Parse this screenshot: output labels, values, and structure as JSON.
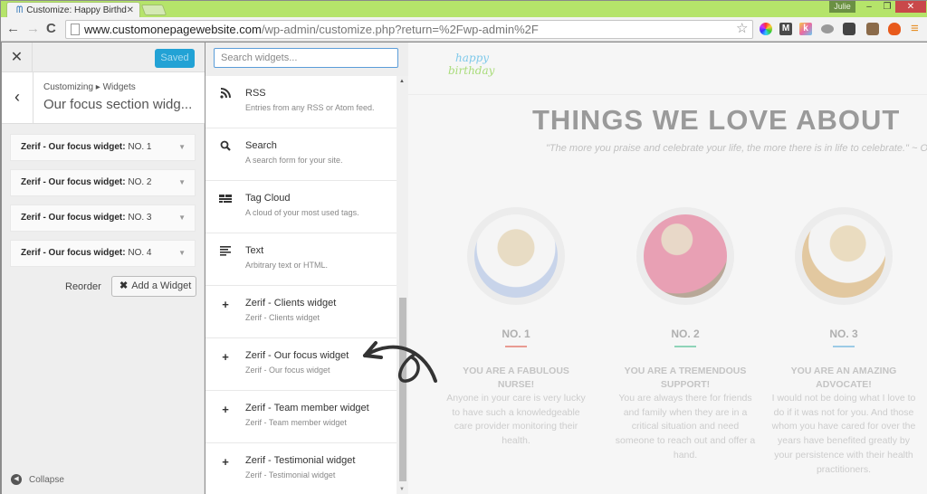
{
  "browser": {
    "tab_title": "Customize: Happy Birthda",
    "tab_close": "✕",
    "profile_name": "Julie",
    "url_domain": "www.customonepagewebsite.com",
    "url_path": "/wp-admin/customize.php?return=%2Fwp-admin%2F",
    "window_controls": {
      "minimize": "–",
      "maximize": "❐",
      "close": "✕"
    },
    "nav": {
      "back": "←",
      "forward": "→",
      "reload": "C"
    },
    "extensions": [
      "color-wheel-icon",
      "m-icon",
      "k-icon",
      "eye-icon",
      "evernote-icon",
      "instagram-icon",
      "fire-icon"
    ],
    "star": "☆",
    "menu": "≡"
  },
  "customizer": {
    "close_icon": "✕",
    "saved_label": "Saved",
    "back_icon": "‹",
    "breadcrumb": "Customizing ▸ Widgets",
    "section_title": "Our focus section widg...",
    "widgets": [
      {
        "type": "Zerif - Our focus widget:",
        "title": "NO. 1"
      },
      {
        "type": "Zerif - Our focus widget:",
        "title": "NO. 2"
      },
      {
        "type": "Zerif - Our focus widget:",
        "title": "NO. 3"
      },
      {
        "type": "Zerif - Our focus widget:",
        "title": "NO. 4"
      }
    ],
    "reorder_label": "Reorder",
    "add_widget_label": "Add a Widget",
    "collapse_label": "Collapse"
  },
  "widget_panel": {
    "search_placeholder": "Search widgets...",
    "items": [
      {
        "icon": "rss-icon",
        "glyph": "◝",
        "name": "RSS",
        "desc": "Entries from any RSS or Atom feed."
      },
      {
        "icon": "search-icon",
        "glyph": "⚲",
        "name": "Search",
        "desc": "A search form for your site."
      },
      {
        "icon": "tag-cloud-icon",
        "glyph": "▤",
        "name": "Tag Cloud",
        "desc": "A cloud of your most used tags."
      },
      {
        "icon": "text-icon",
        "glyph": "≡",
        "name": "Text",
        "desc": "Arbitrary text or HTML."
      },
      {
        "icon": "plus-icon",
        "glyph": "+",
        "name": "Zerif - Clients widget",
        "desc": "Zerif - Clients widget"
      },
      {
        "icon": "plus-icon",
        "glyph": "+",
        "name": "Zerif - Our focus widget",
        "desc": "Zerif - Our focus widget"
      },
      {
        "icon": "plus-icon",
        "glyph": "+",
        "name": "Zerif - Team member widget",
        "desc": "Zerif - Team member widget"
      },
      {
        "icon": "plus-icon",
        "glyph": "+",
        "name": "Zerif - Testimonial widget",
        "desc": "Zerif - Testimonial widget"
      }
    ]
  },
  "preview": {
    "logo_line1": "happy",
    "logo_line2": "birthday",
    "title": "THINGS WE LOVE ABOUT",
    "quote": "\"The more you praise and celebrate your life, the more there is in life to celebrate.\" ~ Op",
    "focus": [
      {
        "num": "NO. 1",
        "accent": "#e99b92",
        "heading": "YOU ARE A FABULOUS NURSE!",
        "body": "Anyone in your care is very lucky to have such a knowledgeable care provider monitoring their health."
      },
      {
        "num": "NO. 2",
        "accent": "#8fd4b8",
        "heading": "YOU ARE A TREMENDOUS SUPPORT!",
        "body": "You are always there for friends and family when they are in a critical situation and need someone to reach out and offer a hand."
      },
      {
        "num": "NO. 3",
        "accent": "#9ccbe6",
        "heading": "YOU ARE AN AMAZING ADVOCATE!",
        "body": "I would not be doing what I love to do if it was not for you. And those whom you have cared for over the years have benefited greatly by your persistence with their health practitioners."
      }
    ]
  },
  "colors": {
    "titlebar": "#b5e46a",
    "saved_button": "#22a2d5",
    "window_close": "#c9484a"
  }
}
